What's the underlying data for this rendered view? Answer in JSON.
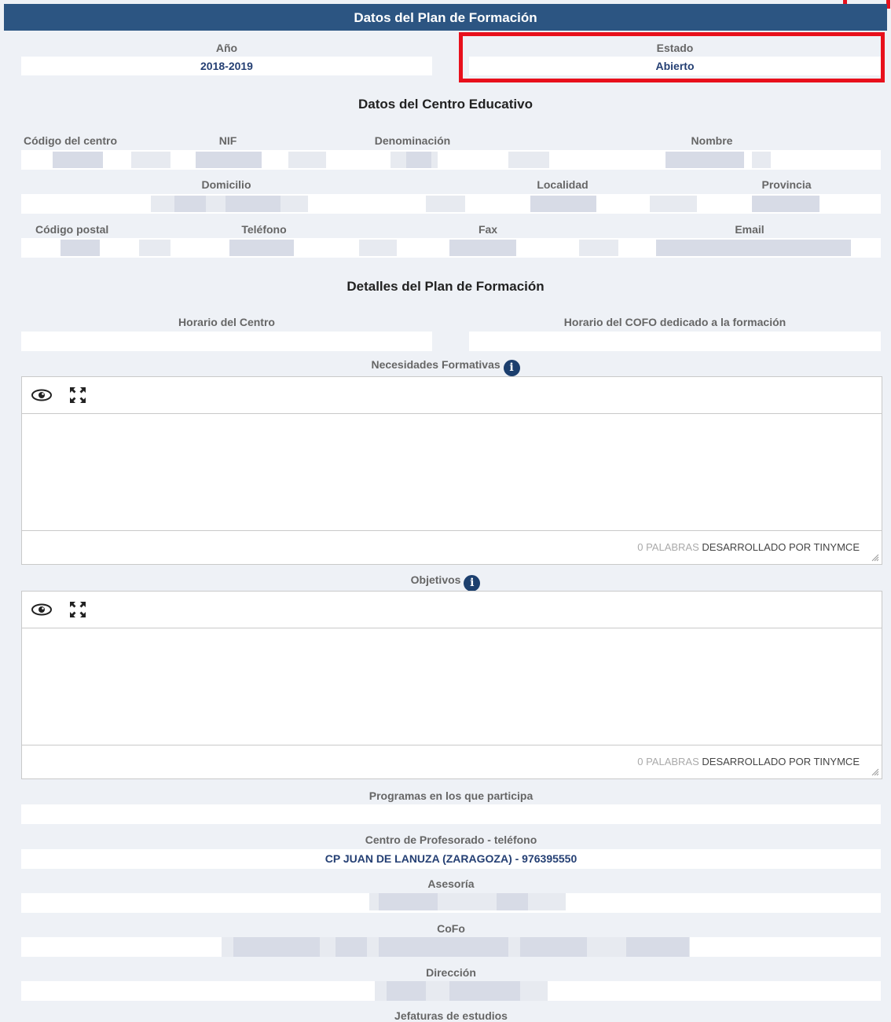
{
  "header": {
    "title": "Datos del Plan de Formación"
  },
  "plan": {
    "year_label": "Año",
    "year_value": "2018-2019",
    "status_label": "Estado",
    "status_value": "Abierto"
  },
  "centro": {
    "section_title": "Datos del Centro Educativo",
    "codigo_label": "Código del centro",
    "nif_label": "NIF",
    "denominacion_label": "Denominación",
    "nombre_label": "Nombre",
    "domicilio_label": "Domicilio",
    "localidad_label": "Localidad",
    "provincia_label": "Provincia",
    "cp_label": "Código postal",
    "telefono_label": "Teléfono",
    "fax_label": "Fax",
    "email_label": "Email"
  },
  "detalles": {
    "section_title": "Detalles del Plan de Formación",
    "horario_centro_label": "Horario del Centro",
    "horario_cofo_label": "Horario del COFO dedicado a la formación",
    "necesidades_label": "Necesidades Formativas",
    "objetivos_label": "Objetivos",
    "programas_label": "Programas en los que participa",
    "cep_label": "Centro de Profesorado - teléfono",
    "cep_value": "CP JUAN DE LANUZA (ZARAGOZA) - 976395550",
    "asesoria_label": "Asesoría",
    "cofo_label": "CoFo",
    "direccion_label": "Dirección",
    "jefaturas_label": "Jefaturas de estudios"
  },
  "editor": {
    "word_count": "0 PALABRAS",
    "powered_by": "DESARROLLADO POR TINYMCE",
    "icons": [
      "eye-icon",
      "fullscreen-icon",
      "info-icon"
    ]
  },
  "colors": {
    "header_bg": "#2c5582",
    "highlight": "#e8101c",
    "value_text": "#243f73",
    "background": "#eef1f6"
  }
}
